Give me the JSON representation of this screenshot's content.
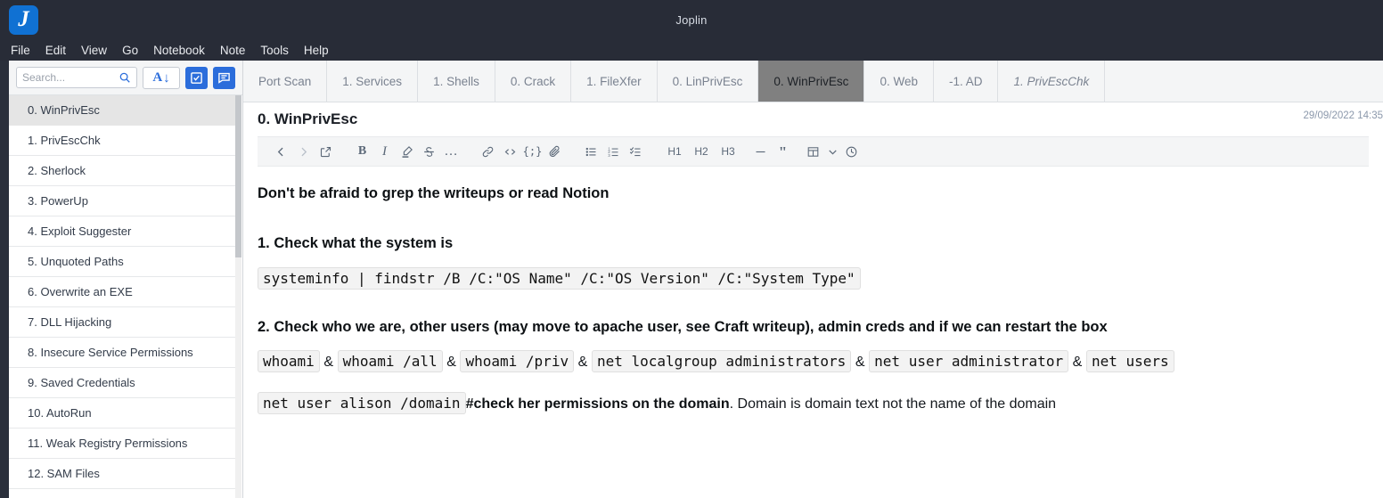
{
  "window": {
    "title": "Joplin",
    "logo_glyph": "J",
    "logo_color": "#1071d3"
  },
  "menu": {
    "items": [
      "File",
      "Edit",
      "View",
      "Go",
      "Notebook",
      "Note",
      "Tools",
      "Help"
    ]
  },
  "sidebar": {
    "search": {
      "placeholder": "Search...",
      "value": "",
      "icon": "search-icon"
    },
    "buttons": [
      {
        "name": "sort-notes-button",
        "glyph_letter": "A",
        "glyph_arrow": "↓"
      },
      {
        "name": "new-todo-button",
        "icon": "checkbox-icon"
      },
      {
        "name": "new-note-button",
        "icon": "note-icon"
      }
    ],
    "notes": [
      {
        "label": "0. WinPrivEsc",
        "selected": true
      },
      {
        "label": "1. PrivEscChk",
        "selected": false
      },
      {
        "label": "2. Sherlock",
        "selected": false
      },
      {
        "label": "3. PowerUp",
        "selected": false
      },
      {
        "label": "4. Exploit Suggester",
        "selected": false
      },
      {
        "label": "5. Unquoted Paths",
        "selected": false
      },
      {
        "label": "6. Overwrite an EXE",
        "selected": false
      },
      {
        "label": "7. DLL Hijacking",
        "selected": false
      },
      {
        "label": "8. Insecure Service Permissions",
        "selected": false
      },
      {
        "label": "9. Saved Credentials",
        "selected": false
      },
      {
        "label": "10. AutoRun",
        "selected": false
      },
      {
        "label": "11. Weak Registry Permissions",
        "selected": false
      },
      {
        "label": "12. SAM Files",
        "selected": false
      }
    ]
  },
  "tabs": [
    {
      "label": "Port Scan",
      "active": false,
      "italic": false
    },
    {
      "label": "1. Services",
      "active": false,
      "italic": false
    },
    {
      "label": "1. Shells",
      "active": false,
      "italic": false
    },
    {
      "label": "0. Crack",
      "active": false,
      "italic": false
    },
    {
      "label": "1. FileXfer",
      "active": false,
      "italic": false
    },
    {
      "label": "0. LinPrivEsc",
      "active": false,
      "italic": false
    },
    {
      "label": "0. WinPrivEsc",
      "active": true,
      "italic": false
    },
    {
      "label": "0. Web",
      "active": false,
      "italic": false
    },
    {
      "label": "-1. AD",
      "active": false,
      "italic": false
    },
    {
      "label": "1. PrivEscChk",
      "active": false,
      "italic": true
    }
  ],
  "note": {
    "title": "0. WinPrivEsc",
    "date": "29/09/2022 14:35",
    "toolbar": [
      {
        "name": "back-icon",
        "label": "‹"
      },
      {
        "name": "forward-icon",
        "label": "›"
      },
      {
        "name": "external-link-icon",
        "label": "↗"
      },
      {
        "name": "bold-icon",
        "label": "B"
      },
      {
        "name": "italic-icon",
        "label": "I"
      },
      {
        "name": "highlight-icon",
        "label": "✎"
      },
      {
        "name": "strikethrough-icon",
        "label": "S"
      },
      {
        "name": "more-options-icon",
        "label": "…"
      },
      {
        "name": "link-icon",
        "label": "🔗"
      },
      {
        "name": "inline-code-icon",
        "label": "<>"
      },
      {
        "name": "code-block-icon",
        "label": "{;}"
      },
      {
        "name": "attach-file-icon",
        "label": "📎"
      },
      {
        "name": "bulleted-list-icon",
        "label": "☰"
      },
      {
        "name": "numbered-list-icon",
        "label": "☰"
      },
      {
        "name": "checkbox-list-icon",
        "label": "☑"
      },
      {
        "name": "heading-1-button",
        "label": "H1"
      },
      {
        "name": "heading-2-button",
        "label": "H2"
      },
      {
        "name": "heading-3-button",
        "label": "H3"
      },
      {
        "name": "horizontal-rule-icon",
        "label": "—"
      },
      {
        "name": "blockquote-icon",
        "label": "\""
      },
      {
        "name": "insert-table-icon",
        "label": "▦"
      },
      {
        "name": "chevron-down-icon",
        "label": "⌄"
      },
      {
        "name": "insert-time-icon",
        "label": "⏱"
      }
    ],
    "content": {
      "intro_heading": "Don't be afraid to grep the writeups or read Notion",
      "section1_heading": "1. Check what the system is",
      "section1_code": "systeminfo | findstr /B /C:\"OS Name\" /C:\"OS Version\" /C:\"System Type\"",
      "section2_heading": "2. Check who we are, other users (may move to apache user, see Craft writeup), admin creds and if we can restart the box",
      "section2_codes": [
        "whoami",
        "whoami /all",
        "whoami /priv",
        "net localgroup administrators",
        "net user administrator",
        "net users"
      ],
      "section2_separator": "&",
      "section3_code": "net user alison /domain",
      "section3_bold": "#check her permissions on the domain",
      "section3_plain": ". Domain is domain text not the name of the domain"
    }
  }
}
